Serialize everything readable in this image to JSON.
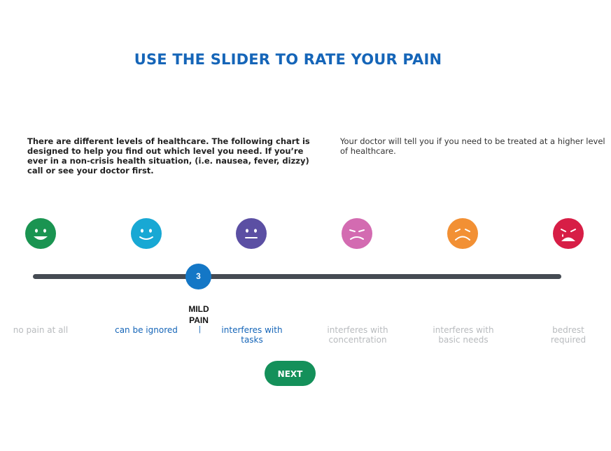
{
  "title": "USE THE SLIDER TO RATE YOUR PAIN",
  "intro_left": "There are different levels of healthcare. The following chart is designed to help you find out which level you need. If you’re ever in a non-crisis health situation, (i.e. nausea, fever, dizzy) call or see your doctor first.",
  "intro_right": "Your doctor will tell you if you need to be treated at a higher level of healthcare.",
  "faces": [
    {
      "icon": "very-happy-face-icon",
      "color": "#1a9451"
    },
    {
      "icon": "happy-face-icon",
      "color": "#18a8d4"
    },
    {
      "icon": "neutral-face-icon",
      "color": "#5b4fa3"
    },
    {
      "icon": "sad-face-icon",
      "color": "#d36bb1"
    },
    {
      "icon": "frown-face-icon",
      "color": "#f29034"
    },
    {
      "icon": "crying-face-icon",
      "color": "#d71e46"
    }
  ],
  "slider": {
    "value": "3",
    "level_name": "MILD PAIN",
    "tick": "|"
  },
  "labels": [
    "no pain at all",
    "can be ignored",
    "interferes with tasks",
    "interferes with concentration",
    "interferes with basic needs",
    "bedrest required"
  ],
  "next_label": "NEXT",
  "colors": {
    "title": "#1565b8",
    "track": "#454b53",
    "thumb": "#1477c6",
    "active_label": "#1565b8",
    "inactive_label": "#b8bbbe",
    "next_button": "#14905a"
  }
}
